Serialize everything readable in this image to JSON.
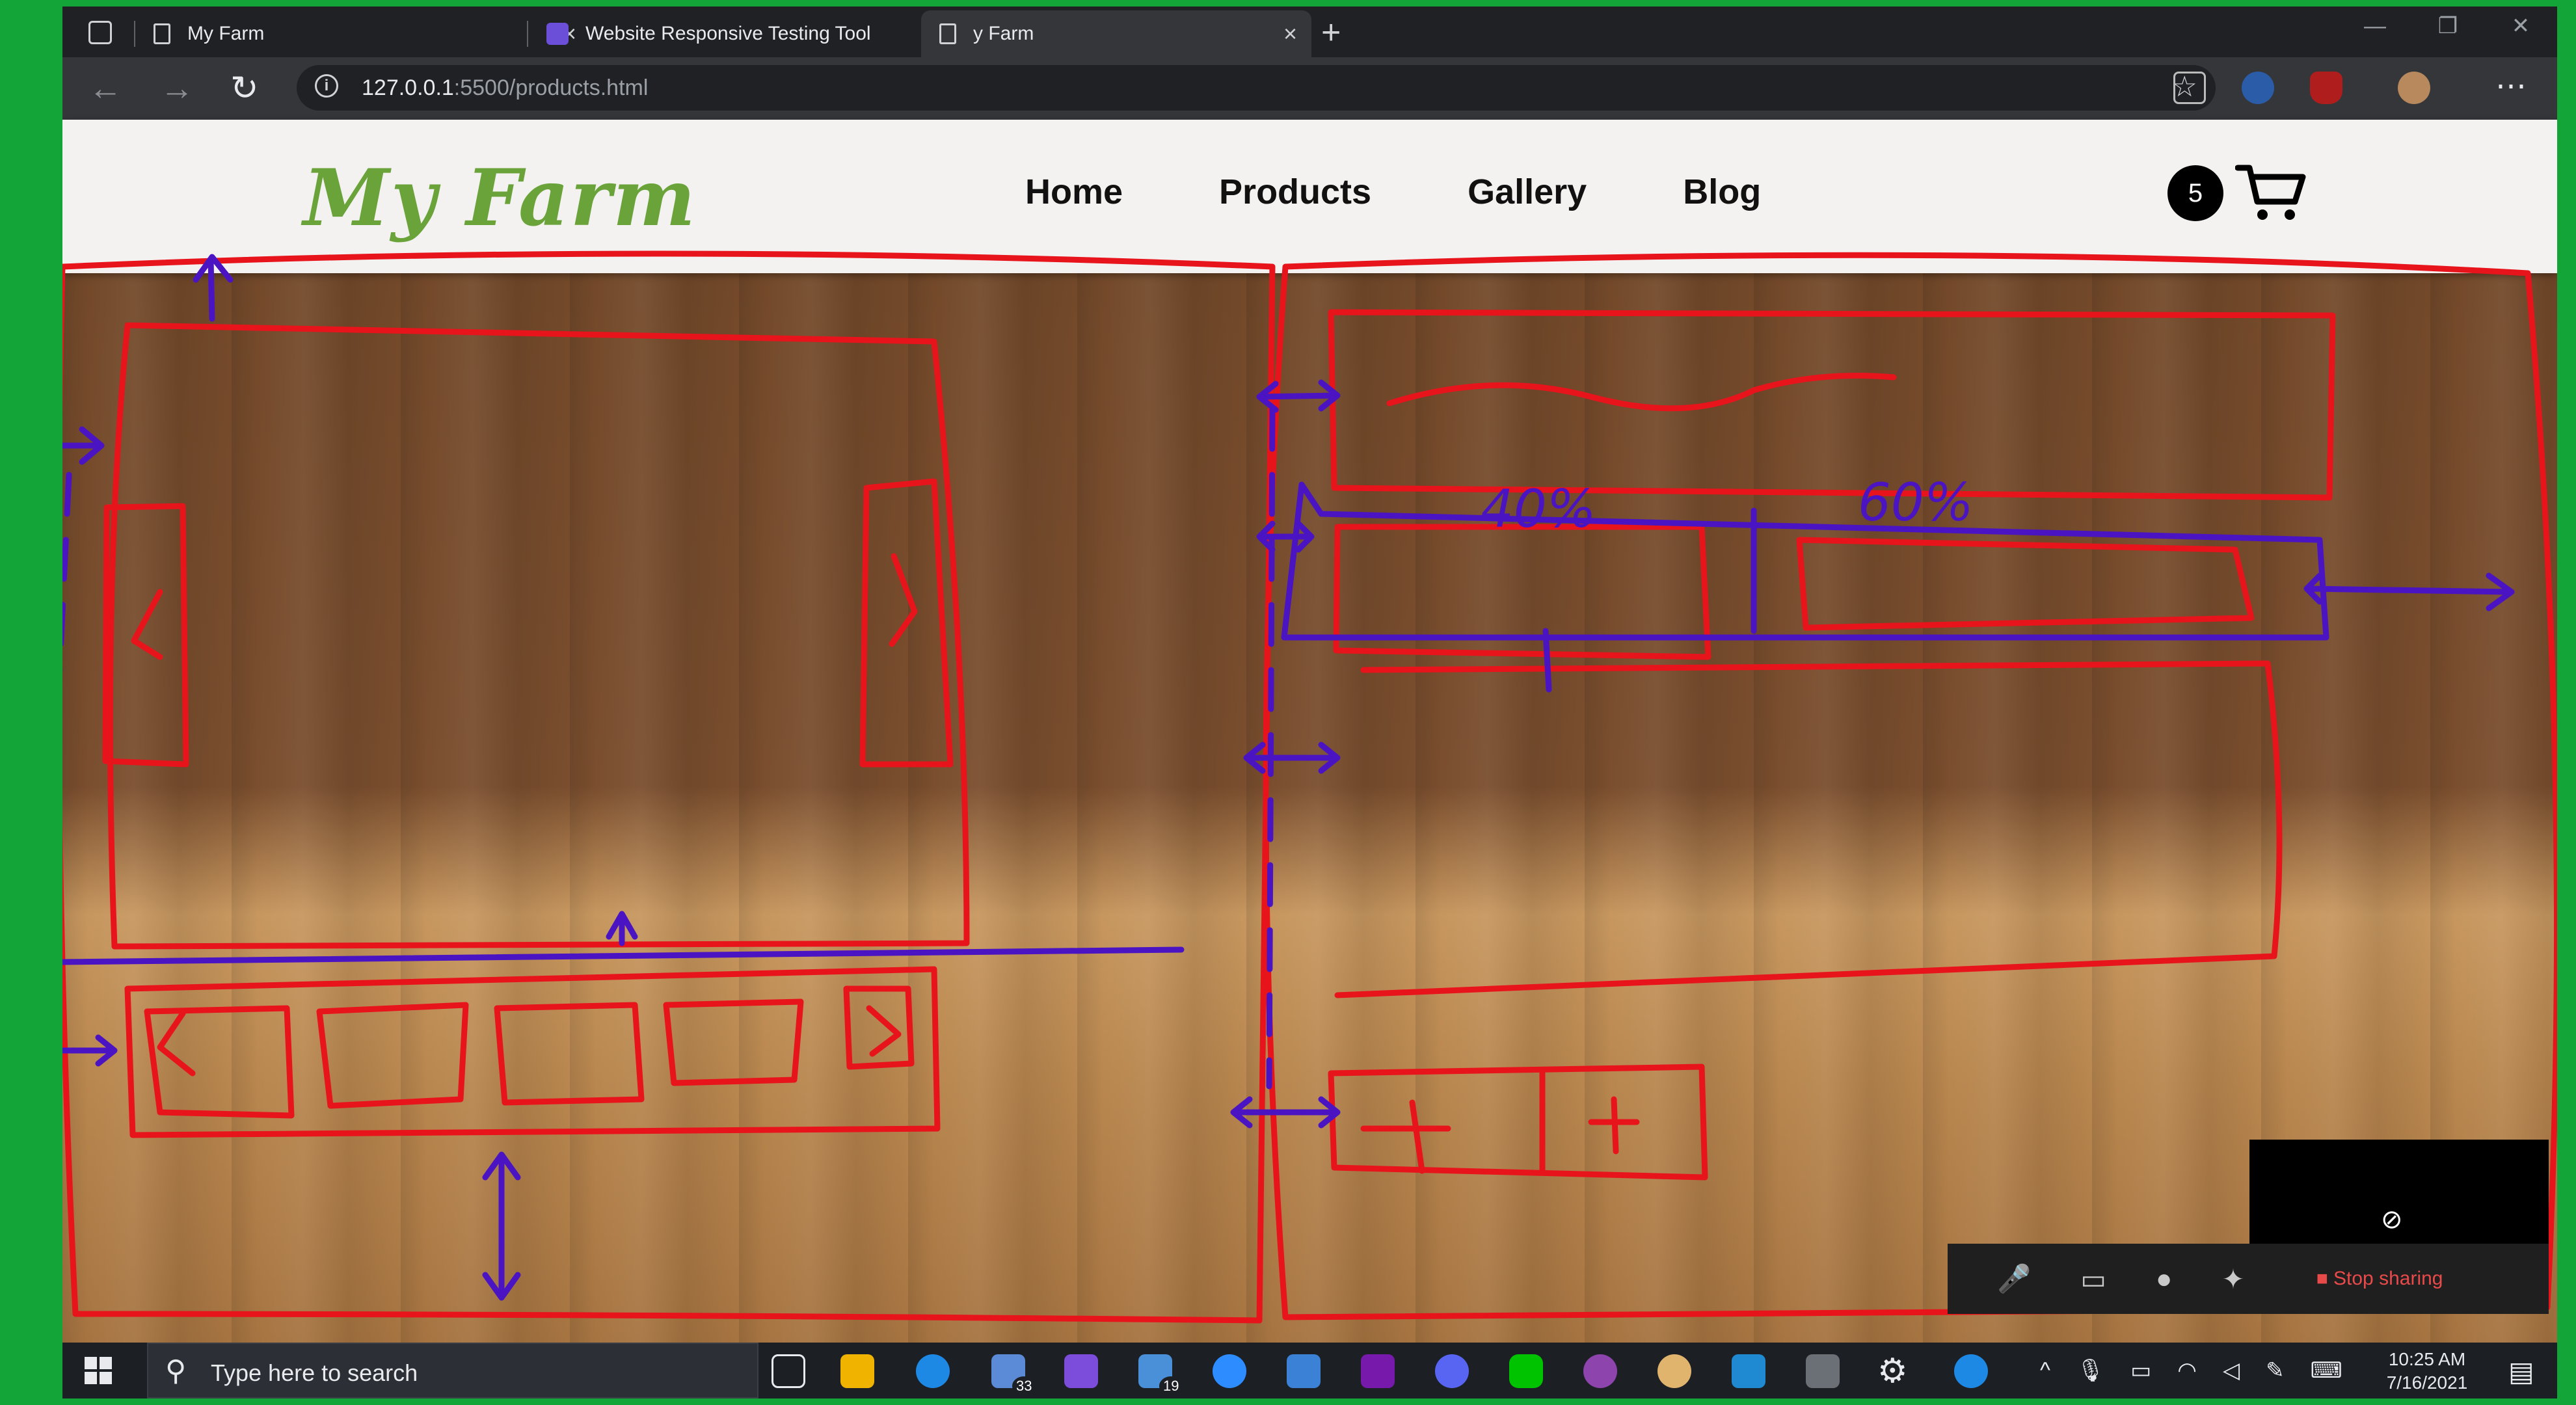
{
  "browser": {
    "tabs": [
      {
        "title": "My Farm",
        "icon": "page-icon",
        "active": false
      },
      {
        "title": "Website Responsive Testing Tool",
        "icon": "responsive-tool-icon",
        "active": false
      },
      {
        "title": "y Farm",
        "icon": "page-icon",
        "active": true
      }
    ],
    "address": {
      "host": "127.0.0.1",
      "path": ":5500/products.html"
    },
    "accent": "#13a538"
  },
  "site": {
    "logo": "My Farm",
    "nav": [
      "Home",
      "Products",
      "Gallery",
      "Blog"
    ],
    "cart_count": "5"
  },
  "sketch_annotations": {
    "left_percent": "40%",
    "right_percent": "60%"
  },
  "zoom": {
    "stop_sharing": "Stop sharing"
  },
  "taskbar": {
    "search_placeholder": "Type here to search",
    "mail_badge": "33",
    "files_badge": "19",
    "time": "10:25 AM",
    "date": "7/16/2021"
  }
}
